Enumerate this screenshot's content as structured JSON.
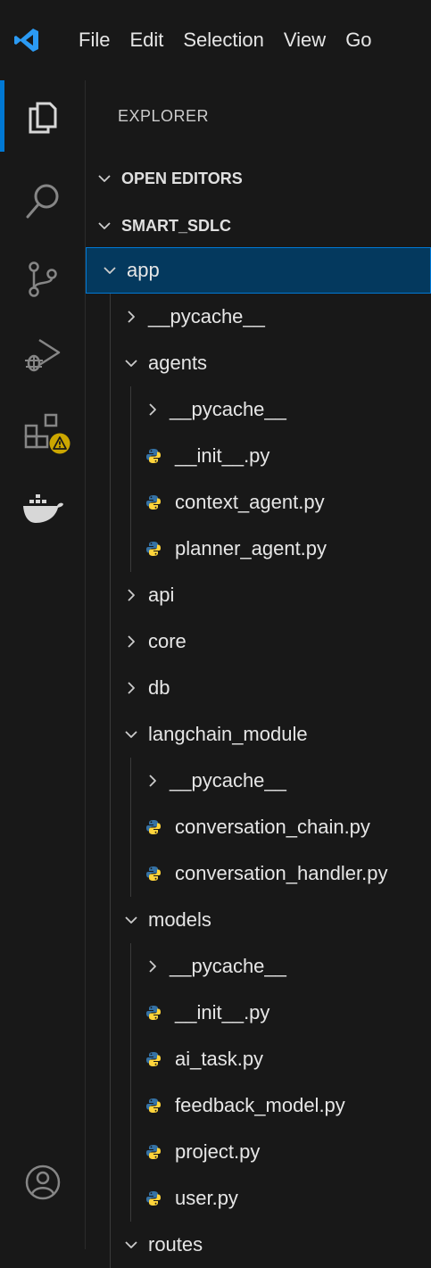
{
  "menu": [
    "File",
    "Edit",
    "Selection",
    "View",
    "Go"
  ],
  "activity": [
    {
      "icon": "files-icon",
      "active": true
    },
    {
      "icon": "search-icon"
    },
    {
      "icon": "source-control-icon"
    },
    {
      "icon": "run-debug-icon"
    },
    {
      "icon": "extensions-icon",
      "badge": "warning"
    },
    {
      "icon": "docker-icon"
    },
    {
      "icon": "account-icon"
    }
  ],
  "sidebar": {
    "title": "EXPLORER",
    "open_editors": "OPEN EDITORS",
    "workspace": "SMART_SDLC",
    "tree": [
      {
        "label": "app",
        "type": "folder",
        "expanded": true,
        "depth": 0,
        "selected": true
      },
      {
        "label": "__pycache__",
        "type": "folder",
        "expanded": false,
        "depth": 1
      },
      {
        "label": "agents",
        "type": "folder",
        "expanded": true,
        "depth": 1
      },
      {
        "label": "__pycache__",
        "type": "folder",
        "expanded": false,
        "depth": 2
      },
      {
        "label": "__init__.py",
        "type": "py",
        "depth": 2
      },
      {
        "label": "context_agent.py",
        "type": "py",
        "depth": 2
      },
      {
        "label": "planner_agent.py",
        "type": "py",
        "depth": 2
      },
      {
        "label": "api",
        "type": "folder",
        "expanded": false,
        "depth": 1
      },
      {
        "label": "core",
        "type": "folder",
        "expanded": false,
        "depth": 1
      },
      {
        "label": "db",
        "type": "folder",
        "expanded": false,
        "depth": 1
      },
      {
        "label": "langchain_module",
        "type": "folder",
        "expanded": true,
        "depth": 1
      },
      {
        "label": "__pycache__",
        "type": "folder",
        "expanded": false,
        "depth": 2
      },
      {
        "label": "conversation_chain.py",
        "type": "py",
        "depth": 2
      },
      {
        "label": "conversation_handler.py",
        "type": "py",
        "depth": 2
      },
      {
        "label": "models",
        "type": "folder",
        "expanded": true,
        "depth": 1
      },
      {
        "label": "__pycache__",
        "type": "folder",
        "expanded": false,
        "depth": 2
      },
      {
        "label": "__init__.py",
        "type": "py",
        "depth": 2
      },
      {
        "label": "ai_task.py",
        "type": "py",
        "depth": 2
      },
      {
        "label": "feedback_model.py",
        "type": "py",
        "depth": 2
      },
      {
        "label": "project.py",
        "type": "py",
        "depth": 2
      },
      {
        "label": "user.py",
        "type": "py",
        "depth": 2
      },
      {
        "label": "routes",
        "type": "folder",
        "expanded": true,
        "depth": 1
      }
    ]
  },
  "colors": {
    "accent": "#0078d4",
    "selection": "#04395e",
    "python_blue": "#3572A5",
    "python_yellow": "#FFD43B",
    "warning": "#cca700"
  }
}
